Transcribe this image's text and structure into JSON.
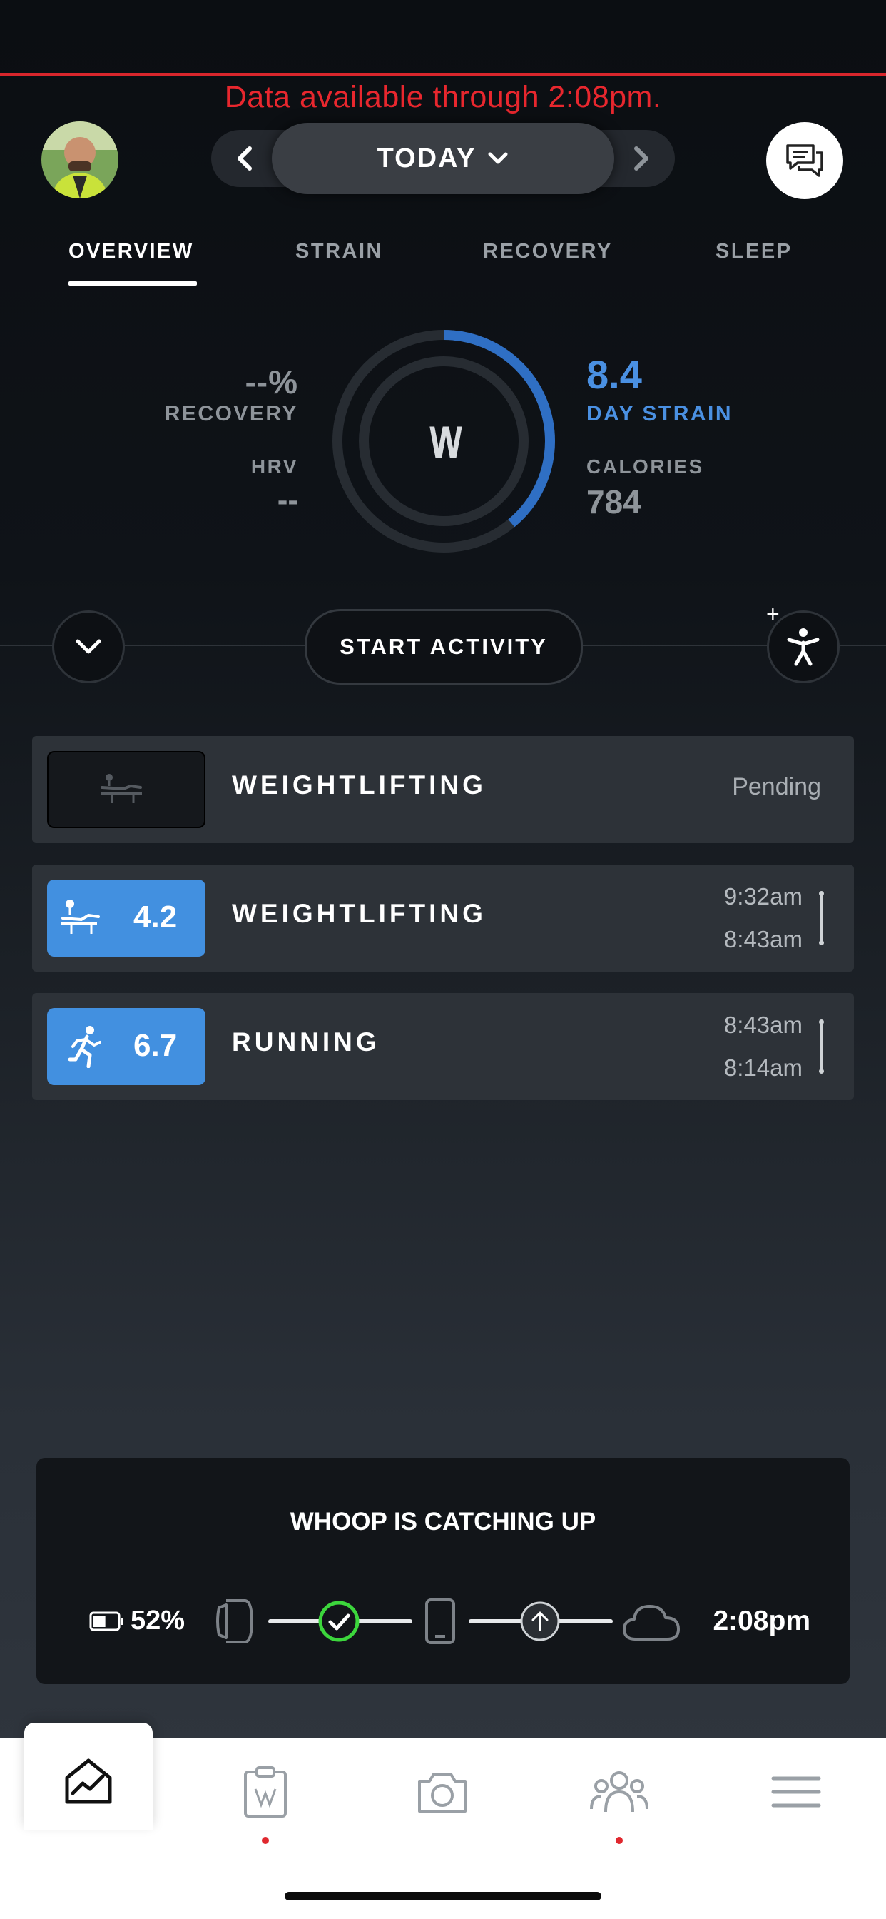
{
  "banner": {
    "text": "Data available through 2:08pm."
  },
  "header": {
    "date_label": "TODAY",
    "icons": [
      "avatar",
      "chevron-left-icon",
      "chevron-down-icon",
      "chevron-right-icon",
      "chat-icon"
    ]
  },
  "tabs": [
    {
      "label": "OVERVIEW",
      "active": true
    },
    {
      "label": "STRAIN",
      "active": false
    },
    {
      "label": "RECOVERY",
      "active": false
    },
    {
      "label": "SLEEP",
      "active": false
    }
  ],
  "overview": {
    "recovery_value": "--%",
    "recovery_label": "RECOVERY",
    "hrv_label": "HRV",
    "hrv_value": "--",
    "strain_value": "8.4",
    "strain_label": "DAY STRAIN",
    "calories_label": "CALORIES",
    "calories_value": "784",
    "strain_fraction": 0.39,
    "logo_text": "\\/\\/"
  },
  "actions": {
    "start_label": "START ACTIVITY",
    "add_label": "+"
  },
  "activities": [
    {
      "name": "WEIGHTLIFTING",
      "status": "Pending",
      "icon": "weightlifting-icon"
    },
    {
      "name": "WEIGHTLIFTING",
      "score": "4.2",
      "end": "9:32am",
      "start": "8:43am",
      "icon": "weightlifting-icon"
    },
    {
      "name": "RUNNING",
      "score": "6.7",
      "end": "8:43am",
      "start": "8:14am",
      "icon": "running-icon"
    }
  ],
  "sync": {
    "title": "WHOOP IS CATCHING UP",
    "battery": "52%",
    "battery_level": 0.52,
    "time": "2:08pm"
  },
  "nav": {
    "items": [
      "home-icon",
      "journal-icon",
      "camera-icon",
      "community-icon",
      "menu-icon"
    ]
  },
  "colors": {
    "accent": "#4a90e2",
    "alert": "#e8272e",
    "success": "#3cd63c"
  }
}
